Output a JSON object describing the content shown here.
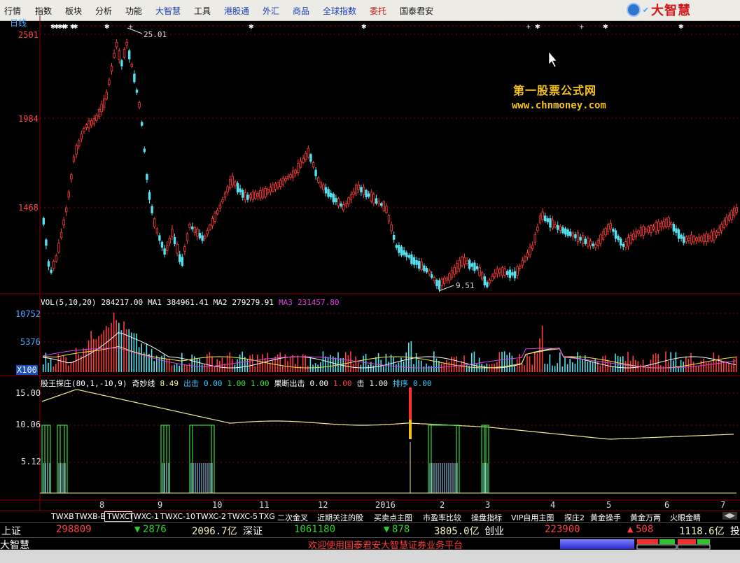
{
  "menu": {
    "items": [
      {
        "label": "行情",
        "style": "normal"
      },
      {
        "label": "指数",
        "style": "normal"
      },
      {
        "label": "板块",
        "style": "normal"
      },
      {
        "label": "分析",
        "style": "normal"
      },
      {
        "label": "功能",
        "style": "normal"
      },
      {
        "label": "大智慧",
        "style": "blue"
      },
      {
        "label": "工具",
        "style": "normal"
      },
      {
        "label": "港股通",
        "style": "blue"
      },
      {
        "label": "外汇",
        "style": "blue"
      },
      {
        "label": "商品",
        "style": "blue"
      },
      {
        "label": "全球指数",
        "style": "blue"
      },
      {
        "label": "委托",
        "style": "red"
      },
      {
        "label": "国泰君安",
        "style": "normal"
      }
    ],
    "logo_text": "大智慧"
  },
  "chart": {
    "period_label": "日线",
    "price_axis": [
      "2501",
      "1984",
      "1468"
    ],
    "high_label": "25.01",
    "low_label": "9.51",
    "watermark_title": "第一股票公式网",
    "watermark_url": "www.chnmoney.com",
    "vol_info": [
      {
        "text": "VOL(5,10,20)",
        "color": "#ffffff"
      },
      {
        "text": "284217.00",
        "color": "#ffffff"
      },
      {
        "text": "MA1",
        "color": "#ffffff"
      },
      {
        "text": "384961.41",
        "color": "#ffffff"
      },
      {
        "text": "MA2",
        "color": "#ffffff"
      },
      {
        "text": "279279.91",
        "color": "#ffffff"
      },
      {
        "text": "MA3",
        "color": "#e040e0"
      },
      {
        "text": "231457.80",
        "color": "#e040e0"
      }
    ],
    "vol_axis": [
      "10752",
      "5376",
      "X100"
    ],
    "ind_info": [
      {
        "text": "股王探庄(80,1,-10,9)",
        "color": "#ffffff"
      },
      {
        "text": "奇妙线",
        "color": "#ffffff"
      },
      {
        "text": "8.49",
        "color": "#f1f19a"
      },
      {
        "text": "出击",
        "color": "#40c8ff"
      },
      {
        "text": "0.00",
        "color": "#40c8ff"
      },
      {
        "text": "1.00",
        "color": "#40e040"
      },
      {
        "text": "1.00",
        "color": "#40e040"
      },
      {
        "text": "果断出击",
        "color": "#ffffff"
      },
      {
        "text": "0.00",
        "color": "#ffffff"
      },
      {
        "text": "1.00",
        "color": "#ff4040"
      },
      {
        "text": "击",
        "color": "#ffffff"
      },
      {
        "text": "1.00",
        "color": "#ffffff"
      },
      {
        "text": "排序",
        "color": "#40c8ff"
      },
      {
        "text": "0.00",
        "color": "#40c8ff"
      }
    ],
    "ind_axis": [
      "15.00",
      "10.06",
      "5.12"
    ],
    "date_labels": [
      "8",
      "9",
      "10",
      "11",
      "12",
      "2016",
      "2",
      "3",
      "4",
      "5",
      "6",
      "7"
    ]
  },
  "tabs": [
    "TWXB",
    "TWXB-B",
    "TWXC",
    "TWXC-1",
    "TWXC-10",
    "TWXC-2",
    "TWXC-5",
    "TXG",
    "二次金叉",
    "近期关注的股",
    "买卖点主图",
    "市盈率比较",
    "操盘指标",
    "VIP自用主图",
    "探庄2",
    "黄金操手",
    "黄金万两",
    "火眼金睛"
  ],
  "ticker": {
    "sh_name": "上证",
    "sh_index": "298809",
    "sh_change": "2876",
    "sh_amount": "2096.7亿",
    "sz_name": "深证",
    "sz_index": "1061180",
    "sz_change": "878",
    "sz_amount": "3805.0亿",
    "cy_name": "创业",
    "cy_index": "223900",
    "cy_change": "508",
    "cy_amount": "1118.6亿",
    "trail": "投"
  },
  "status": {
    "app_name": "大智慧",
    "message": "欢迎使用国泰君安大智慧证券业务平台"
  },
  "colors": {
    "up": "#ff3b3b",
    "down": "#54e1f0",
    "ma1": "#ffffff",
    "ma2": "#f5e84a",
    "ma3": "#e040e0",
    "grid": "#8b0000",
    "signal": "#37d437",
    "curve": "#efef9a"
  }
}
